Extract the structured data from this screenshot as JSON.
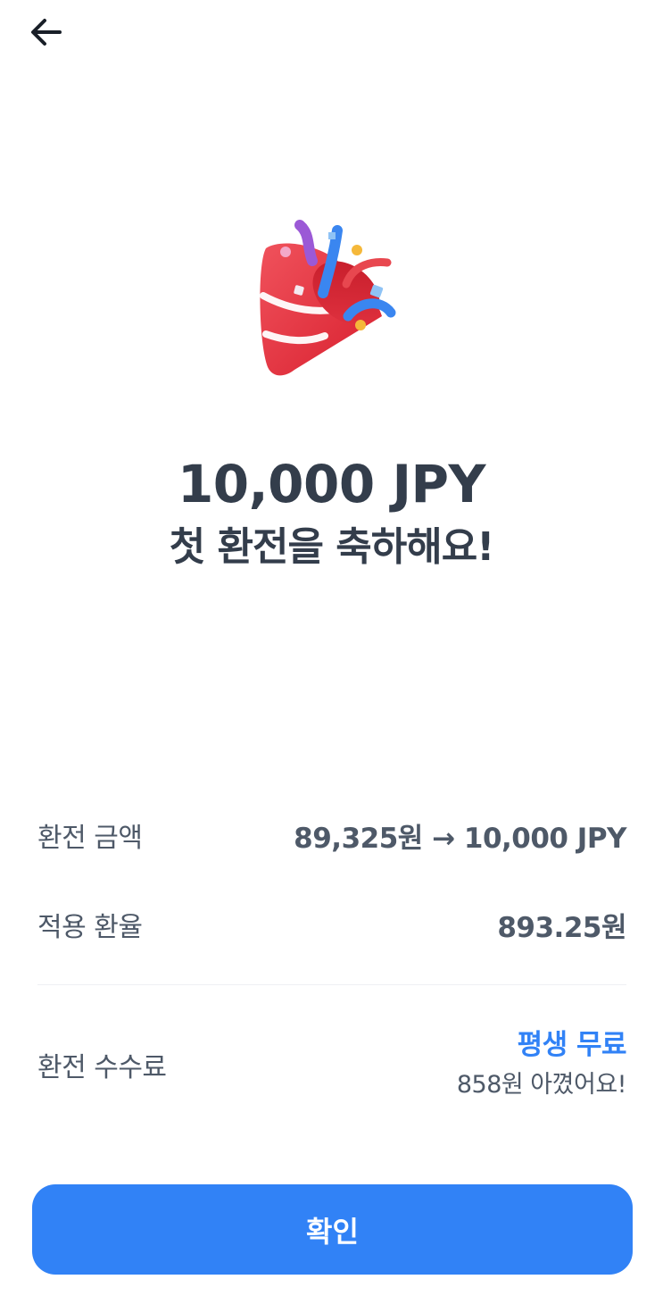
{
  "header": {
    "back_icon": "arrow-left-icon"
  },
  "illustration": {
    "icon": "party-popper-icon"
  },
  "headline": {
    "amount": "10,000 JPY",
    "message": "첫 환전을 축하해요!"
  },
  "details": {
    "exchange_amount": {
      "label": "환전 금액",
      "value": "89,325원 → 10,000 JPY"
    },
    "exchange_rate": {
      "label": "적용 환율",
      "value": "893.25원"
    },
    "fee": {
      "label": "환전 수수료",
      "value": "평생 무료",
      "note": "858원 아꼈어요!"
    }
  },
  "confirm_button": {
    "label": "확인"
  },
  "colors": {
    "accent": "#3182f6",
    "text_primary": "#333d4b",
    "text_secondary": "#4e5968"
  }
}
